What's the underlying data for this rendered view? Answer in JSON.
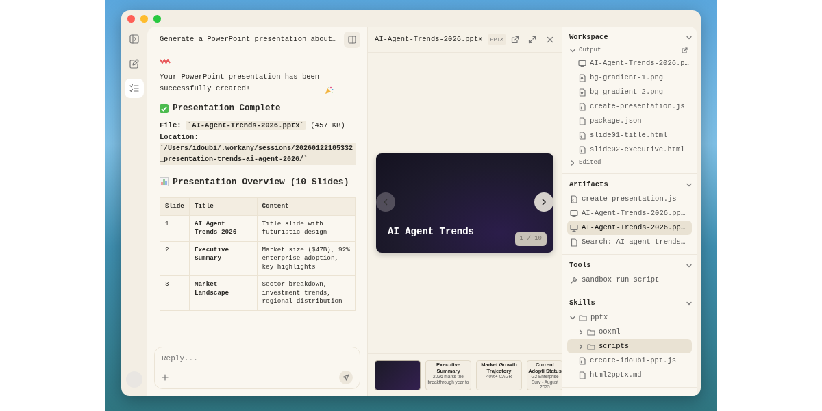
{
  "chat": {
    "title": "Generate a PowerPoint presentation about…",
    "intro": "Your PowerPoint presentation has been successfully created!",
    "complete_heading": "Presentation Complete",
    "file_label": "File:",
    "file_name": "`AI-Agent-Trends-2026.pptx`",
    "file_size": "(457 KB)",
    "location_label": "Location:",
    "location_path": "`/Users/idoubi/.workany/sessions/20260122185332_presentation-trends-ai-agent-2026/`",
    "overview_heading": "Presentation Overview (10 Slides)",
    "table": {
      "columns": [
        "Slide",
        "Title",
        "Content"
      ],
      "rows": [
        [
          "1",
          "AI Agent Trends 2026",
          "Title slide with futuristic design"
        ],
        [
          "2",
          "Executive Summary",
          "Market size ($47B), 92% enterprise adoption, key highlights"
        ],
        [
          "3",
          "Market Landscape",
          "Sector breakdown, investment trends, regional distribution"
        ]
      ]
    },
    "reply": {
      "placeholder": "Reply..."
    }
  },
  "preview": {
    "file_name": "AI-Agent-Trends-2026.pptx",
    "badge": "PPTX",
    "slide_title": "AI Agent Trends",
    "counter": "1 / 10",
    "thumbnails": [
      {
        "kind": "image",
        "selected": true
      },
      {
        "kind": "text",
        "selected": false,
        "title": "Executive Summary",
        "subtitle": "2026 marks the breakthrough year fo"
      },
      {
        "kind": "text",
        "selected": false,
        "title": "Market Growth Trajectory",
        "subtitle": "40%+ CAGR"
      },
      {
        "kind": "text",
        "selected": false,
        "title": "Current Adopti Status",
        "subtitle": "G2 Enterprise Surv - August 2025"
      }
    ]
  },
  "sidebar": {
    "sections": [
      {
        "title": "Workspace",
        "expanded": true,
        "items": [
          {
            "kind": "group",
            "label": "Output",
            "expanded": true,
            "external_link": true,
            "selected": false,
            "children": [
              {
                "kind": "slides",
                "label": "AI-Agent-Trends-2026.p…",
                "selected": false
              },
              {
                "kind": "image",
                "label": "bg-gradient-1.png",
                "selected": false
              },
              {
                "kind": "image",
                "label": "bg-gradient-2.png",
                "selected": false
              },
              {
                "kind": "code",
                "label": "create-presentation.js",
                "selected": false
              },
              {
                "kind": "document",
                "label": "package.json",
                "selected": false
              },
              {
                "kind": "code",
                "label": "slide01-title.html",
                "selected": false
              },
              {
                "kind": "code",
                "label": "slide02-executive.html",
                "selected": false
              }
            ]
          },
          {
            "kind": "group",
            "label": "Edited",
            "expanded": false,
            "selected": false
          }
        ]
      },
      {
        "title": "Artifacts",
        "expanded": true,
        "items": [
          {
            "kind": "code",
            "label": "create-presentation.js",
            "selected": false
          },
          {
            "kind": "slides",
            "label": "AI-Agent-Trends-2026.pp…",
            "selected": false
          },
          {
            "kind": "slides",
            "label": "AI-Agent-Trends-2026.pp…",
            "selected": true
          },
          {
            "kind": "document",
            "label": "Search: AI agent trends…",
            "selected": false
          }
        ]
      },
      {
        "title": "Tools",
        "expanded": true,
        "items": [
          {
            "kind": "tool",
            "label": "sandbox_run_script",
            "selected": false
          }
        ]
      },
      {
        "title": "Skills",
        "expanded": true,
        "items": [
          {
            "kind": "folder",
            "label": "pptx",
            "expanded": true,
            "selected": false,
            "children": [
              {
                "kind": "folder",
                "label": "ooxml",
                "expanded": false,
                "selected": false
              },
              {
                "kind": "folder",
                "label": "scripts",
                "expanded": false,
                "selected": true
              },
              {
                "kind": "code",
                "label": "create-idoubi-ppt.js",
                "selected": false
              },
              {
                "kind": "document",
                "label": "html2pptx.md",
                "selected": false
              }
            ]
          }
        ]
      }
    ]
  }
}
